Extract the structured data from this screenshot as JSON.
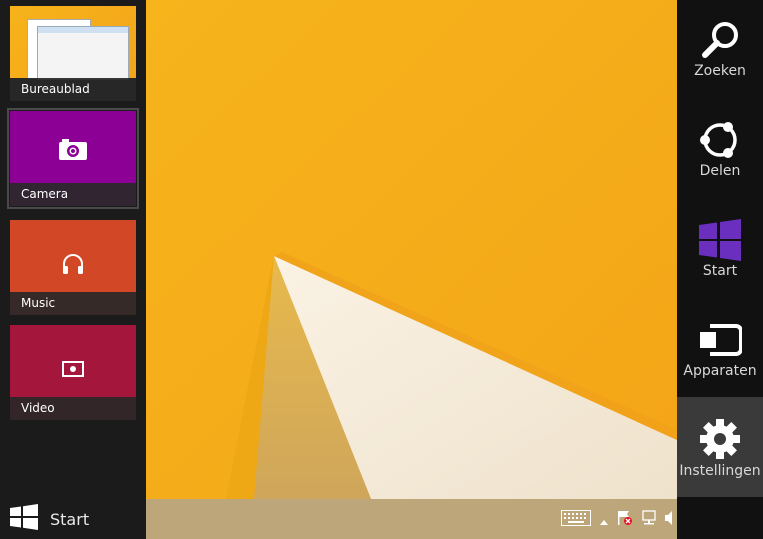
{
  "switcher": {
    "tiles": [
      {
        "label": "Bureaublad",
        "color": "#f7b31a",
        "icon": "desktop-thumbnail"
      },
      {
        "label": "Camera",
        "color": "#8c0095",
        "icon": "camera-icon"
      },
      {
        "label": "Music",
        "color": "#d24726",
        "icon": "headphones-icon"
      },
      {
        "label": "Video",
        "color": "#a4163c",
        "icon": "video-icon"
      }
    ],
    "start_label": "Start"
  },
  "charms": [
    {
      "label": "Zoeken",
      "icon": "search-icon"
    },
    {
      "label": "Delen",
      "icon": "share-icon"
    },
    {
      "label": "Start",
      "icon": "windows-logo-icon",
      "color": "#6b2fbf"
    },
    {
      "label": "Apparaten",
      "icon": "devices-icon"
    },
    {
      "label": "Instellingen",
      "icon": "gear-icon",
      "active": true
    }
  ],
  "taskbar": {
    "tray_icons": [
      "keyboard-icon",
      "chevron-up-icon",
      "action-center-flag-icon",
      "network-icon",
      "volume-icon"
    ]
  }
}
